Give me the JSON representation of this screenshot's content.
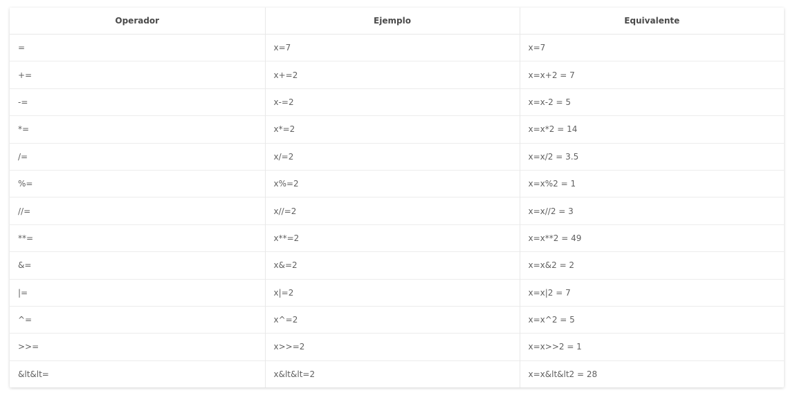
{
  "table": {
    "headers": [
      "Operador",
      "Ejemplo",
      "Equivalente"
    ],
    "rows": [
      [
        "=",
        "x=7",
        "x=7"
      ],
      [
        "+=",
        "x+=2",
        "x=x+2 = 7"
      ],
      [
        "-=",
        "x-=2",
        "x=x-2 = 5"
      ],
      [
        "*=",
        "x*=2",
        "x=x*2 = 14"
      ],
      [
        "/=",
        "x/=2",
        "x=x/2 = 3.5"
      ],
      [
        "%=",
        "x%=2",
        "x=x%2 = 1"
      ],
      [
        "//=",
        "x//=2",
        "x=x//2 = 3"
      ],
      [
        "**=",
        "x**=2",
        "x=x**2 = 49"
      ],
      [
        "&=",
        "x&=2",
        "x=x&2 = 2"
      ],
      [
        "|=",
        "x|=2",
        "x=x|2 = 7"
      ],
      [
        "^=",
        "x^=2",
        "x=x^2 = 5"
      ],
      [
        ">>=",
        "x>>=2",
        "x=x>>2 = 1"
      ],
      [
        "&lt&lt=",
        "x&lt&lt=2",
        "x=x&lt&lt2 = 28"
      ]
    ]
  }
}
